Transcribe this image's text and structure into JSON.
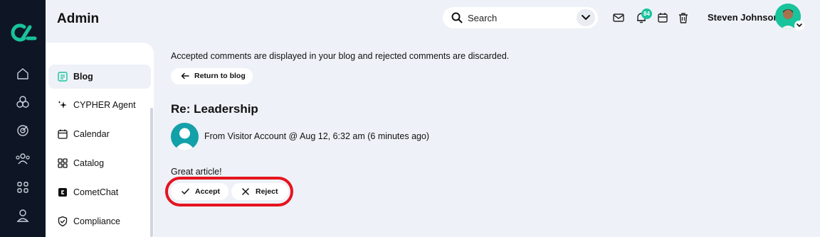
{
  "app": {
    "title": "Admin"
  },
  "header": {
    "search_placeholder": "Search",
    "notifications_count": "84",
    "user_name": "Steven Johnson"
  },
  "rail": {
    "icons": [
      "logo-icon",
      "home-icon",
      "modules-icon",
      "target-icon",
      "users-icon",
      "apps-grid-icon",
      "profile-icon"
    ]
  },
  "sidebar": {
    "items": [
      {
        "label": "Blog",
        "icon": "blog-icon",
        "active": true
      },
      {
        "label": "CYPHER Agent",
        "icon": "sparkle-icon",
        "active": false
      },
      {
        "label": "Calendar",
        "icon": "calendar-icon",
        "active": false
      },
      {
        "label": "Catalog",
        "icon": "catalog-grid-icon",
        "active": false
      },
      {
        "label": "CometChat",
        "icon": "cometchat-icon",
        "active": false
      },
      {
        "label": "Compliance",
        "icon": "shield-check-icon",
        "active": false
      }
    ]
  },
  "main": {
    "intro": "Accepted comments are displayed in your blog and rejected comments are discarded.",
    "return_label": "Return to blog",
    "comment": {
      "title": "Re: Leadership",
      "meta": "From Visitor Account @ Aug 12, 6:32 am (6 minutes ago)",
      "body": "Great article!"
    },
    "accept_label": "Accept",
    "reject_label": "Reject"
  },
  "colors": {
    "accent": "#19c39c",
    "rail_bg": "#0e1626",
    "page_bg": "#eef1f7",
    "highlight": "#e5141f"
  }
}
